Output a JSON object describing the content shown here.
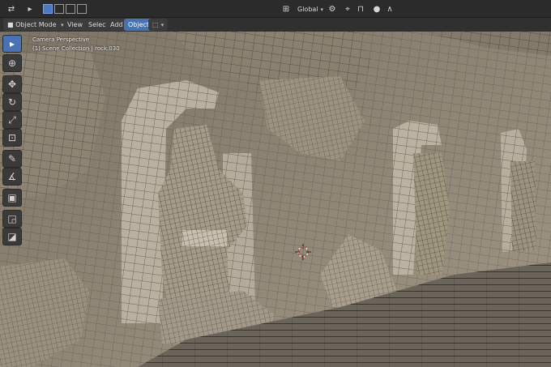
{
  "topbar": {
    "transform_orientation": "Global",
    "icons": [
      "transform-pivot-icon",
      "cursor-select-icon",
      "select-box-icon",
      "select-extend-icon",
      "select-subtract-icon",
      "select-invert-icon",
      "snap-icon",
      "proportional-edit-icon"
    ]
  },
  "header": {
    "mode": "Object Mode",
    "menus": [
      "View",
      "Select",
      "Add",
      "Object"
    ],
    "active_menu": "Object"
  },
  "overlay": {
    "view_name": "Camera Perspective",
    "collection_info": "(1) Scene Collection | rock.030"
  },
  "toolbar": {
    "tools": [
      "select-box-icon",
      "cursor-icon",
      "move-icon",
      "rotate-icon",
      "scale-icon",
      "transform-icon",
      "annotate-icon",
      "measure-icon",
      "add-cube-icon",
      "extrude-icon",
      "shrink-icon"
    ],
    "active_tool": "select-box-icon"
  },
  "colors": {
    "ui_dark": "#2b2b2b",
    "accent": "#4772b3",
    "mesh_base": "#8f8576",
    "wire": "#2d2925"
  }
}
